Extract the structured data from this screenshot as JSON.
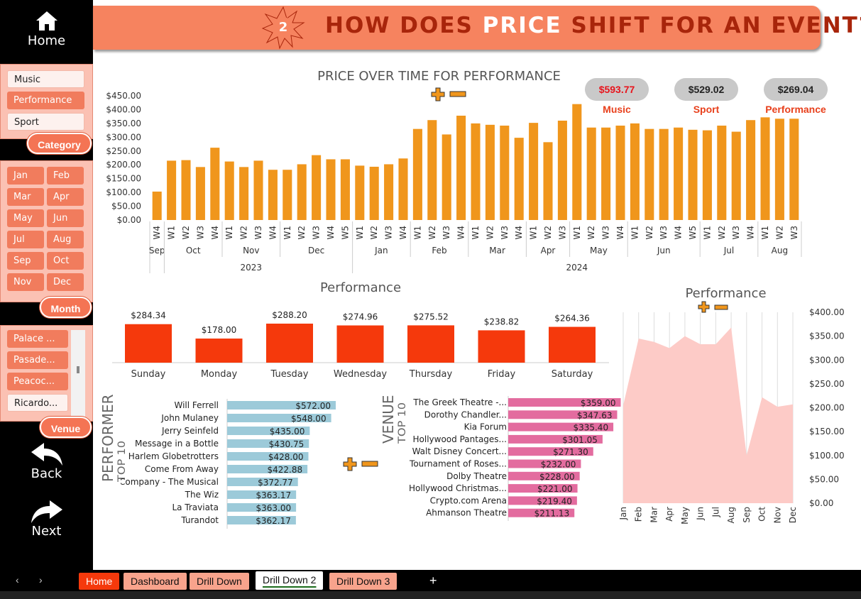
{
  "nav": {
    "home": "Home",
    "back": "Back",
    "next": "Next"
  },
  "slicers": {
    "category": {
      "label": "Category",
      "items": [
        "Music",
        "Performance",
        "Sport"
      ],
      "selected": "Performance"
    },
    "month": {
      "label": "Month",
      "items": [
        "Jan",
        "Feb",
        "Mar",
        "Apr",
        "May",
        "Jun",
        "Jul",
        "Aug",
        "Sep",
        "Oct",
        "Nov",
        "Dec"
      ]
    },
    "venue": {
      "label": "Venue",
      "items": [
        "Palace ...",
        "Pasade...",
        "Peacoc...",
        "Ricardo..."
      ],
      "selected": "Ricardo..."
    }
  },
  "header": {
    "badge": "2",
    "title_pre": "HOW DOES ",
    "title_hl": "PRICE",
    "title_post": " SHIFT FOR AN EVENT?"
  },
  "top_chart": {
    "title": "PRICE OVER TIME FOR PERFORMANCE",
    "y_ticks": [
      "$450.00",
      "$400.00",
      "$350.00",
      "$300.00",
      "$250.00",
      "$200.00",
      "$150.00",
      "$100.00",
      "$50.00",
      "$0.00"
    ],
    "weeks": [
      "W4",
      "W1",
      "W2",
      "W3",
      "W4",
      "W1",
      "W2",
      "W3",
      "W4",
      "W1",
      "W2",
      "W3",
      "W4",
      "W5",
      "W1",
      "W2",
      "W3",
      "W4",
      "W1",
      "W2",
      "W3",
      "W4",
      "W1",
      "W2",
      "W3",
      "W4",
      "W1",
      "W2",
      "W3",
      "W1",
      "W2",
      "W3",
      "W4",
      "W1",
      "W2",
      "W3",
      "W4",
      "W5",
      "W1",
      "W2",
      "W3",
      "W4",
      "W1",
      "W2",
      "W3"
    ],
    "months": [
      "Sep",
      "Oct",
      "Nov",
      "Dec",
      "Jan",
      "Feb",
      "Mar",
      "Apr",
      "May",
      "Jun",
      "Jul",
      "Aug"
    ],
    "years": [
      "2023",
      "2024"
    ]
  },
  "bubbles": [
    {
      "value": "$593.77",
      "label": "Music",
      "value_color": "#e8141c"
    },
    {
      "value": "$529.02",
      "label": "Sport",
      "value_color": "#222222"
    },
    {
      "value": "$269.04",
      "label": "Performance",
      "value_color": "#222222"
    }
  ],
  "weekday_chart": {
    "title": "Performance",
    "days": [
      "Sunday",
      "Monday",
      "Tuesday",
      "Wednesday",
      "Thursday",
      "Friday",
      "Saturday"
    ],
    "labels": [
      "$284.34",
      "$178.00",
      "$288.20",
      "$274.96",
      "$275.52",
      "$238.82",
      "$264.36"
    ]
  },
  "monthly_area": {
    "title": "Performance",
    "y_ticks": [
      "$400.00",
      "$350.00",
      "$300.00",
      "$250.00",
      "$200.00",
      "$150.00",
      "$100.00",
      "$50.00",
      "$0.00"
    ],
    "months": [
      "Jan",
      "Feb",
      "Mar",
      "Apr",
      "May",
      "Jun",
      "Jul",
      "Aug",
      "Sep",
      "Oct",
      "Nov",
      "Dec"
    ]
  },
  "performer": {
    "title": "PERFORMER",
    "subtitle": "TOP 10",
    "names": [
      "Will Ferrell",
      "John Mulaney",
      "Jerry Seinfeld",
      "Message in a Bottle",
      "Harlem Globetrotters",
      "Come From Away",
      "Company - The Musical",
      "The Wiz",
      "La Traviata",
      "Turandot"
    ],
    "labels": [
      "$572.00",
      "$548.00",
      "$435.00",
      "$430.75",
      "$428.00",
      "$422.88",
      "$372.77",
      "$363.17",
      "$363.00",
      "$362.17"
    ]
  },
  "venue": {
    "title": "VENUE",
    "subtitle": "TOP 10",
    "names": [
      "The Greek Theatre -...",
      "Dorothy Chandler...",
      "Kia Forum",
      "Hollywood Pantages...",
      "Walt Disney Concert...",
      "Tournament of Roses...",
      "Dolby Theatre",
      "Hollywood Christmas...",
      "Crypto.com Arena",
      "Ahmanson Theatre"
    ],
    "labels": [
      "$359.00",
      "$347.63",
      "$335.40",
      "$301.05",
      "$271.30",
      "$232.00",
      "$228.00",
      "$221.00",
      "$219.40",
      "$211.13"
    ]
  },
  "tabs": [
    "Home",
    "Dashboard",
    "Drill Down",
    "Drill Down 2",
    "Drill Down 3"
  ],
  "active_tab": "Drill Down 2",
  "colors": {
    "accent": "#f6835f",
    "bar_orange": "#f0961c",
    "bar_red": "#f5390c",
    "perf_bar": "#9ccad9",
    "venue_bar": "#e36c9f",
    "area": "#fdcbc7"
  },
  "chart_data": [
    {
      "type": "bar",
      "title": "PRICE OVER TIME FOR PERFORMANCE",
      "ylim": [
        0,
        450
      ],
      "x": [
        "2023-Sep-W4",
        "2023-Oct-W1",
        "2023-Oct-W2",
        "2023-Oct-W3",
        "2023-Oct-W4",
        "2023-Nov-W1",
        "2023-Nov-W2",
        "2023-Nov-W3",
        "2023-Nov-W4",
        "2023-Dec-W1",
        "2023-Dec-W2",
        "2023-Dec-W3",
        "2023-Dec-W4",
        "2023-Dec-W5",
        "2024-Jan-W1",
        "2024-Jan-W2",
        "2024-Jan-W3",
        "2024-Jan-W4",
        "2024-Feb-W1",
        "2024-Feb-W2",
        "2024-Feb-W3",
        "2024-Feb-W4",
        "2024-Mar-W1",
        "2024-Mar-W2",
        "2024-Mar-W3",
        "2024-Mar-W4",
        "2024-Apr-W1",
        "2024-Apr-W2",
        "2024-Apr-W3",
        "2024-May-W1",
        "2024-May-W2",
        "2024-May-W3",
        "2024-May-W4",
        "2024-Jun-W1",
        "2024-Jun-W2",
        "2024-Jun-W3",
        "2024-Jun-W4",
        "2024-Jun-W5",
        "2024-Jul-W1",
        "2024-Jul-W2",
        "2024-Jul-W3",
        "2024-Jul-W4",
        "2024-Aug-W1",
        "2024-Aug-W2",
        "2024-Aug-W3"
      ],
      "values": [
        103,
        215,
        217,
        192,
        262,
        212,
        192,
        215,
        182,
        182,
        202,
        235,
        220,
        220,
        197,
        193,
        202,
        223,
        330,
        362,
        310,
        378,
        350,
        345,
        342,
        298,
        352,
        282,
        360,
        420,
        335,
        335,
        342,
        350,
        330,
        330,
        335,
        327,
        325,
        342,
        320,
        362,
        372,
        367,
        367
      ]
    },
    {
      "type": "bar",
      "title": "Performance",
      "categories": [
        "Sunday",
        "Monday",
        "Tuesday",
        "Wednesday",
        "Thursday",
        "Friday",
        "Saturday"
      ],
      "values": [
        284.34,
        178.0,
        288.2,
        274.96,
        275.52,
        238.82,
        264.36
      ]
    },
    {
      "type": "area",
      "title": "Performance",
      "ylim": [
        0,
        400
      ],
      "categories": [
        "Jan",
        "Feb",
        "Mar",
        "Apr",
        "May",
        "Jun",
        "Jul",
        "Aug",
        "Sep",
        "Oct",
        "Nov",
        "Dec"
      ],
      "values": [
        205,
        345,
        338,
        325,
        350,
        333,
        333,
        368,
        100,
        222,
        202,
        207
      ]
    },
    {
      "type": "bar",
      "title": "PERFORMER TOP 10",
      "categories": [
        "Will Ferrell",
        "John Mulaney",
        "Jerry Seinfeld",
        "Message in a Bottle",
        "Harlem Globetrotters",
        "Come From Away",
        "Company - The Musical",
        "The Wiz",
        "La Traviata",
        "Turandot"
      ],
      "values": [
        572.0,
        548.0,
        435.0,
        430.75,
        428.0,
        422.88,
        372.77,
        363.17,
        363.0,
        362.17
      ]
    },
    {
      "type": "bar",
      "title": "VENUE TOP 10",
      "categories": [
        "The Greek Theatre -...",
        "Dorothy Chandler...",
        "Kia Forum",
        "Hollywood Pantages...",
        "Walt Disney Concert...",
        "Tournament of Roses...",
        "Dolby Theatre",
        "Hollywood Christmas...",
        "Crypto.com Arena",
        "Ahmanson Theatre"
      ],
      "values": [
        359.0,
        347.63,
        335.4,
        301.05,
        271.3,
        232.0,
        228.0,
        221.0,
        219.4,
        211.13
      ]
    }
  ]
}
